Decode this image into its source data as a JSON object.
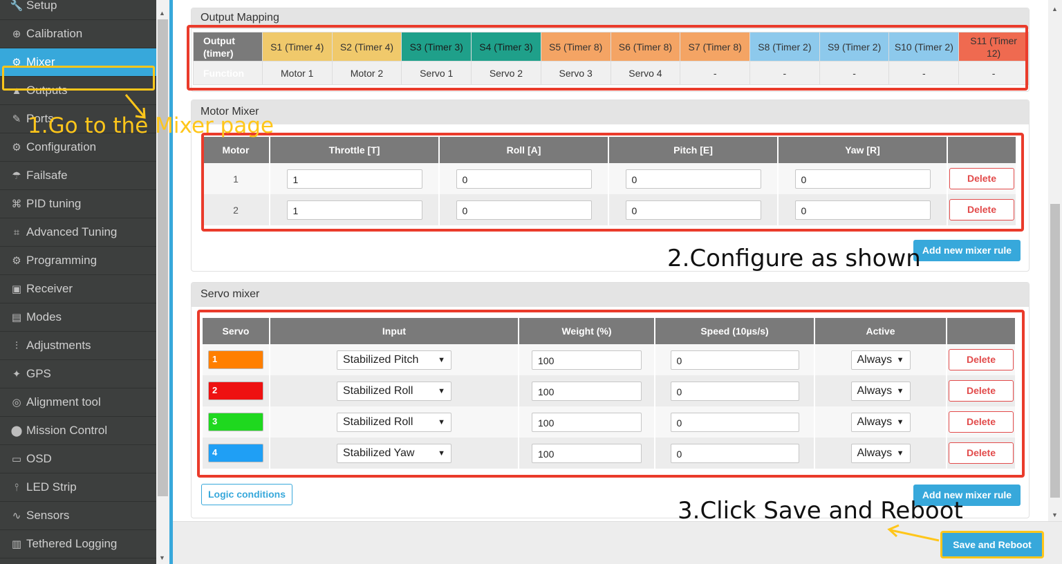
{
  "sidebar": {
    "items": [
      {
        "label": "Setup",
        "icon": "wrench-icon",
        "glyph": "🔧"
      },
      {
        "label": "Calibration",
        "icon": "crosshair-icon",
        "glyph": "⊕"
      },
      {
        "label": "Mixer",
        "icon": "mixer-icon",
        "glyph": "⚙",
        "active": true
      },
      {
        "label": "Outputs",
        "icon": "outputs-icon",
        "glyph": "▲"
      },
      {
        "label": "Ports",
        "icon": "plug-icon",
        "glyph": "✎"
      },
      {
        "label": "Configuration",
        "icon": "gear-icon",
        "glyph": "⚙"
      },
      {
        "label": "Failsafe",
        "icon": "parachute-icon",
        "glyph": "☂"
      },
      {
        "label": "PID tuning",
        "icon": "sitemap-icon",
        "glyph": "⌘"
      },
      {
        "label": "Advanced Tuning",
        "icon": "advanced-tuning-icon",
        "glyph": "⌗"
      },
      {
        "label": "Programming",
        "icon": "gear-icon",
        "glyph": "⚙"
      },
      {
        "label": "Receiver",
        "icon": "receiver-icon",
        "glyph": "▣"
      },
      {
        "label": "Modes",
        "icon": "modes-icon",
        "glyph": "▤"
      },
      {
        "label": "Adjustments",
        "icon": "sliders-icon",
        "glyph": "⫶"
      },
      {
        "label": "GPS",
        "icon": "satellite-icon",
        "glyph": "✦"
      },
      {
        "label": "Alignment tool",
        "icon": "compass-icon",
        "glyph": "◎"
      },
      {
        "label": "Mission Control",
        "icon": "map-marker-icon",
        "glyph": "⬤"
      },
      {
        "label": "OSD",
        "icon": "osd-icon",
        "glyph": "▭"
      },
      {
        "label": "LED Strip",
        "icon": "led-icon",
        "glyph": "⫯"
      },
      {
        "label": "Sensors",
        "icon": "sensors-icon",
        "glyph": "∿"
      },
      {
        "label": "Tethered Logging",
        "icon": "logging-icon",
        "glyph": "▥"
      }
    ]
  },
  "output_mapping": {
    "title": "Output Mapping",
    "header_label": "Output\n(timer)",
    "function_label": "Function",
    "outputs": [
      {
        "label": "S1 (Timer 4)",
        "function": "Motor 1",
        "color": "#f0c96b"
      },
      {
        "label": "S2 (Timer 4)",
        "function": "Motor 2",
        "color": "#f0c96b"
      },
      {
        "label": "S3 (Timer 3)",
        "function": "Servo 1",
        "color": "#1fa08a"
      },
      {
        "label": "S4 (Timer 3)",
        "function": "Servo 2",
        "color": "#1fa08a"
      },
      {
        "label": "S5 (Timer 8)",
        "function": "Servo 3",
        "color": "#f4a464"
      },
      {
        "label": "S6 (Timer 8)",
        "function": "Servo 4",
        "color": "#f4a464"
      },
      {
        "label": "S7 (Timer 8)",
        "function": "-",
        "color": "#f4a464"
      },
      {
        "label": "S8 (Timer 2)",
        "function": "-",
        "color": "#8dc9ec"
      },
      {
        "label": "S9 (Timer 2)",
        "function": "-",
        "color": "#8dc9ec"
      },
      {
        "label": "S10 (Timer 2)",
        "function": "-",
        "color": "#8dc9ec"
      },
      {
        "label": "S11 (Timer 12)",
        "function": "-",
        "color": "#ef6a50"
      }
    ]
  },
  "motor_mixer": {
    "title": "Motor Mixer",
    "columns": [
      "Motor",
      "Throttle [T]",
      "Roll [A]",
      "Pitch [E]",
      "Yaw [R]",
      ""
    ],
    "rows": [
      {
        "motor": "1",
        "throttle": "1",
        "roll": "0",
        "pitch": "0",
        "yaw": "0"
      },
      {
        "motor": "2",
        "throttle": "1",
        "roll": "0",
        "pitch": "0",
        "yaw": "0"
      }
    ],
    "delete_label": "Delete",
    "add_label": "Add new mixer rule"
  },
  "servo_mixer": {
    "title": "Servo mixer",
    "columns": [
      "Servo",
      "Input",
      "Weight (%)",
      "Speed (10µs/s)",
      "Active",
      ""
    ],
    "rows": [
      {
        "servo": "1",
        "color": "#ff7f00",
        "input": "Stabilized Pitch",
        "weight": "100",
        "speed": "0",
        "active": "Always"
      },
      {
        "servo": "2",
        "color": "#ee1111",
        "input": "Stabilized Roll",
        "weight": "100",
        "speed": "0",
        "active": "Always"
      },
      {
        "servo": "3",
        "color": "#1fd81f",
        "input": "Stabilized Roll",
        "weight": "100",
        "speed": "0",
        "active": "Always"
      },
      {
        "servo": "4",
        "color": "#1f9ff5",
        "input": "Stabilized Yaw",
        "weight": "100",
        "speed": "0",
        "active": "Always"
      }
    ],
    "delete_label": "Delete",
    "logic_label": "Logic conditions",
    "add_label": "Add new mixer rule"
  },
  "footer": {
    "save_label": "Save and Reboot"
  },
  "annotations": {
    "step1": "1.Go to the Mixer page",
    "step2": "2.Configure as shown",
    "step3": "3.Click Save and Reboot",
    "highlight_color": "#ffc61a",
    "box_color": "#ea3b2b"
  }
}
